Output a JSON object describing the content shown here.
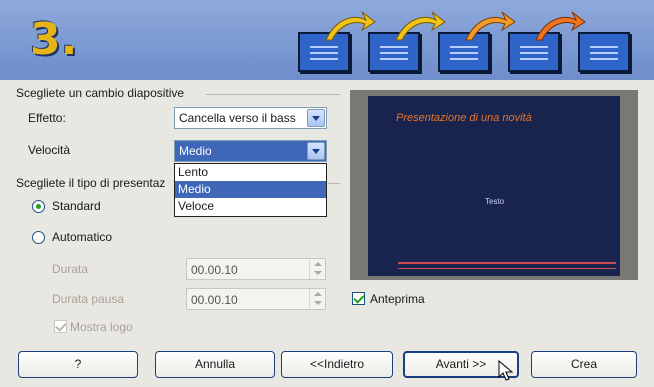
{
  "header": {
    "step_number": "3."
  },
  "section_transition": {
    "title": "Scegliete un cambio diapositive",
    "effect_label": "Effetto:",
    "effect_value": "Cancella verso il bass",
    "speed_label": "Velocità",
    "speed_value": "Medio",
    "speed_options": [
      "Lento",
      "Medio",
      "Veloce"
    ],
    "speed_selected_index": 1
  },
  "section_type": {
    "title": "Scegliete il tipo di presentaz",
    "standard_label": "Standard",
    "automatic_label": "Automatico",
    "selected": "standard",
    "duration_label": "Durata",
    "duration_value": "00.00.10",
    "pause_label": "Durata pausa",
    "pause_value": "00.00.10",
    "show_logo_label": "Mostra logo"
  },
  "preview": {
    "slide_title": "Presentazione di una novità",
    "slide_text": "Testo",
    "checkbox_label": "Anteprima",
    "checked": true
  },
  "buttons": {
    "help": "?",
    "cancel": "Annulla",
    "back": "<<Indietro",
    "next": "Avanti >>",
    "create": "Crea"
  },
  "colors": {
    "banner": "#7a98d1",
    "accent_yellow": "#e5b416",
    "selection_blue": "#3f67b8",
    "slide_background": "#18234e",
    "slide_title": "#e3762f"
  }
}
